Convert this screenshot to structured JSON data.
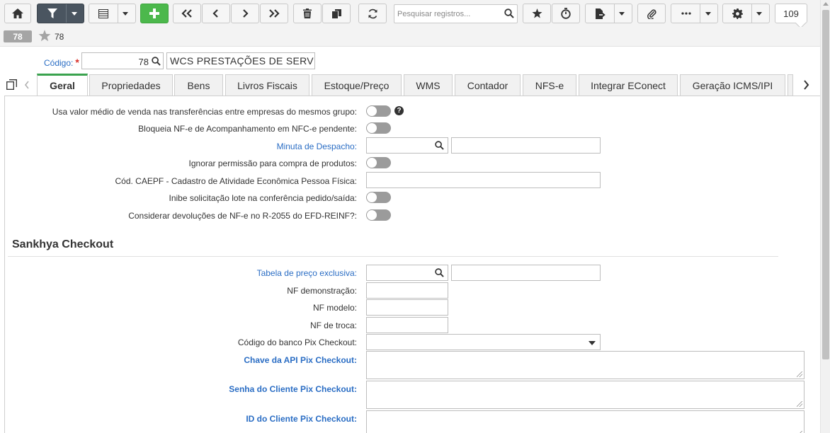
{
  "toolbar": {
    "search_placeholder": "Pesquisar registros...",
    "record_count": "109"
  },
  "record": {
    "badge": "78",
    "favorite_number": "78"
  },
  "header": {
    "code_label": "Código:",
    "required_mark": "*",
    "code_value": "78",
    "name_value": "WCS PRESTAÇÕES DE SERVIÇOS"
  },
  "tabs": [
    {
      "label": "Geral",
      "active": true
    },
    {
      "label": "Propriedades"
    },
    {
      "label": "Bens"
    },
    {
      "label": "Livros Fiscais"
    },
    {
      "label": "Estoque/Preço"
    },
    {
      "label": "WMS"
    },
    {
      "label": "Contador"
    },
    {
      "label": "NFS-e"
    },
    {
      "label": "Integrar EConect"
    },
    {
      "label": "Geração ICMS/IPI"
    }
  ],
  "fields": {
    "valor_medio": "Usa valor médio de venda nas transferências entre empresas do mesmos grupo:",
    "bloqueia_nfe": "Bloqueia NF-e de Acompanhamento em NFC-e pendente:",
    "minuta": "Minuta de Despacho:",
    "ignorar_permissao": "Ignorar permissão para compra de produtos:",
    "caepf": "Cód. CAEPF - Cadastro de Atividade Econômica Pessoa Física:",
    "inibe_lote": "Inibe solicitação lote na conferência pedido/saída:",
    "considerar_devolucoes": "Considerar devoluções de NF-e no R-2055 do EFD-REINF?:"
  },
  "checkout": {
    "title": "Sankhya Checkout",
    "tabela_preco": "Tabela de preço exclusiva:",
    "nf_demonstracao": "NF demonstração:",
    "nf_modelo": "NF modelo:",
    "nf_troca": "NF de troca:",
    "codigo_banco": "Código do banco Pix Checkout:",
    "chave_api": "Chave da API Pix Checkout:",
    "senha_cliente": "Senha do Cliente Pix Checkout:",
    "id_cliente": "ID do Cliente Pix Checkout:"
  },
  "colors": {
    "link": "#2a6dc4",
    "active_tab": "#3aa34e",
    "add_button": "#4cb84c",
    "filter_button": "#4a5560"
  }
}
